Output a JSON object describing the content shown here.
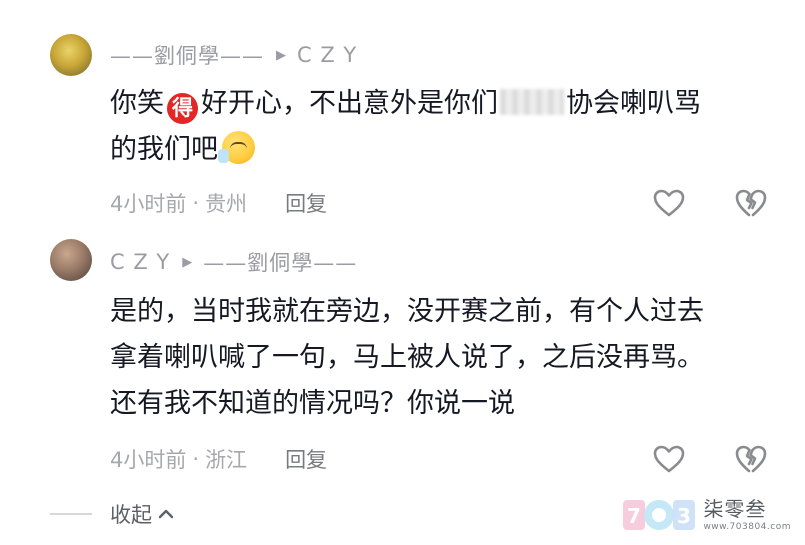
{
  "comments": [
    {
      "author": "——劉侗學——",
      "reply_to": "C Z Y",
      "text_line1_a": "你笑",
      "badge": "得",
      "text_line1_b": "好开心，不出意外是你们",
      "text_line1_c": "协会喇叭骂",
      "text_line2": "的我们吧",
      "emoji": "thinking-face-emoji",
      "time": "4小时前",
      "separator": "·",
      "location": "贵州",
      "reply_label": "回复"
    },
    {
      "author": "C Z Y",
      "reply_to": "——劉侗學——",
      "text_lines": [
        "是的，当时我就在旁边，没开赛之前，有个人过去",
        "拿着喇叭喊了一句，马上被人说了，之后没再骂。",
        "还有我不知道的情况吗？你说一说"
      ],
      "time": "4小时前",
      "separator": "·",
      "location": "浙江",
      "reply_label": "回复"
    }
  ],
  "collapse_label": "收起",
  "watermark": {
    "brand": "柒零叁",
    "url": "www.703804.com"
  },
  "icons": {
    "triangle": "▶",
    "like": "heart-outline-icon",
    "dislike": "broken-heart-icon",
    "collapse": "chevron-up-icon"
  },
  "colors": {
    "text": "#161823",
    "meta": "#a7a8ad",
    "author": "#9b9ca3",
    "badge": "#e32626",
    "icon_stroke": "#8a8b91"
  }
}
